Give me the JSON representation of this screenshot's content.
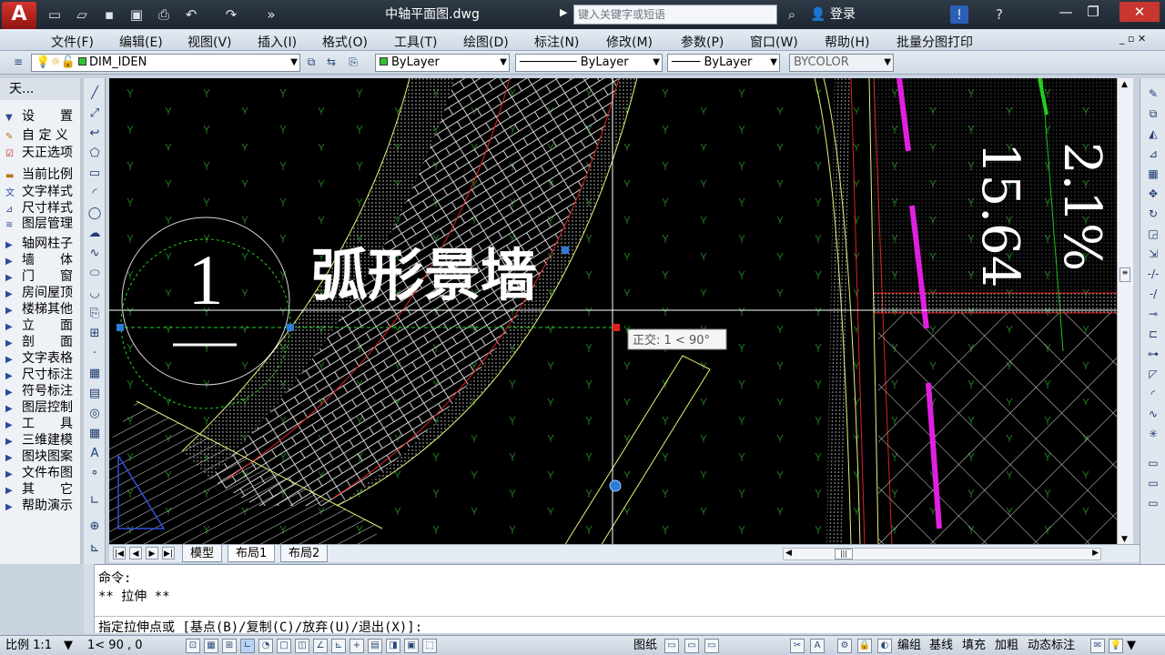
{
  "app": {
    "logo": "A",
    "document_title": "中轴平面图.dwg"
  },
  "search": {
    "placeholder": "键入关键字或短语"
  },
  "login": {
    "label": "登录"
  },
  "menus": [
    "文件(F)",
    "编辑(E)",
    "视图(V)",
    "插入(I)",
    "格式(O)",
    "工具(T)",
    "绘图(D)",
    "标注(N)",
    "修改(M)",
    "参数(P)",
    "窗口(W)",
    "帮助(H)",
    "批量分图打印"
  ],
  "layer_bar": {
    "layer_name": "DIM_IDEN",
    "color": "ByLayer",
    "linetype": "ByLayer",
    "lineweight": "ByLayer",
    "plotstyle": "BYCOLOR"
  },
  "palette": {
    "title": "天...",
    "items": [
      "设　　置",
      "自 定 义",
      "天正选项",
      "当前比例",
      "文字样式",
      "尺寸样式",
      "图层管理",
      "轴网柱子",
      "墙　　体",
      "门　　窗",
      "房间屋顶",
      "楼梯其他",
      "立　　面",
      "剖　　面",
      "文字表格",
      "尺寸标注",
      "符号标注",
      "图层控制",
      "工　　具",
      "三维建模",
      "图块图案",
      "文件布图",
      "其　　它",
      "帮助演示"
    ]
  },
  "drawing": {
    "title_text": "弧形景墙",
    "index_number": "1",
    "dim_value_1": "15.64",
    "dim_value_2": "2.1%",
    "tooltip": "正交: 1 < 90°"
  },
  "tabs": [
    "模型",
    "布局1",
    "布局2"
  ],
  "active_tab": "布局1",
  "command": {
    "line1": "命令:",
    "line2": "** 拉伸 **",
    "prompt": "指定拉伸点或 [基点(B)/复制(C)/放弃(U)/退出(X)]:"
  },
  "status": {
    "scale": "比例 1:1",
    "coords": "1< 90 , 0",
    "paper_label": "图纸",
    "right_items": [
      "编组",
      "基线",
      "填充",
      "加粗",
      "动态标注"
    ]
  },
  "colors": {
    "canvas_bg": "#000000",
    "hatch_white": "#d8d8d8",
    "boundary_yellow": "#e8f27a",
    "accent_red": "#e02020",
    "magenta": "#e020e0",
    "green": "#20d020",
    "grip_blue": "#2f7bd8"
  }
}
